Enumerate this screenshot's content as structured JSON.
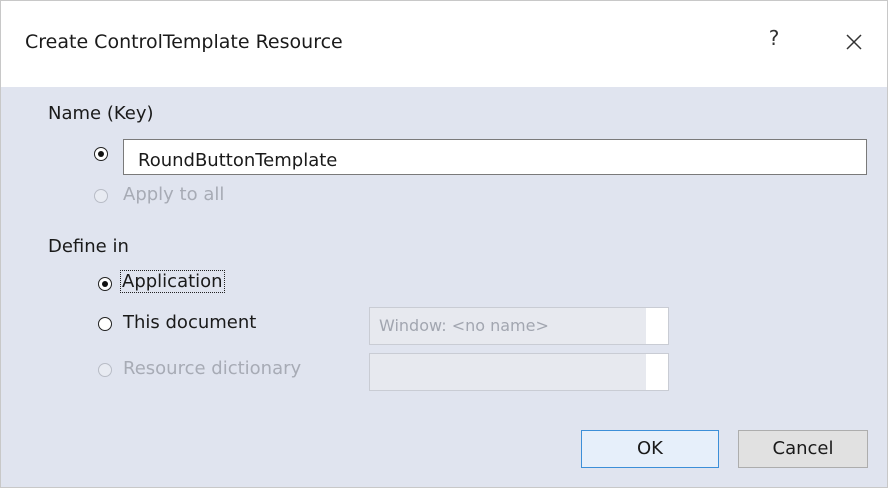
{
  "window": {
    "title": "Create ControlTemplate Resource",
    "help_label": "?",
    "close_icon": "close-icon"
  },
  "name_section": {
    "label": "Name (Key)",
    "key_option_selected": true,
    "key_value": "RoundButtonTemplate",
    "apply_to_all_label": "Apply to all",
    "apply_to_all_enabled": false
  },
  "define_section": {
    "label": "Define in",
    "application_label": "Application",
    "application_selected": true,
    "this_document_label": "This document",
    "this_document_combo_value": "Window: <no name>",
    "resource_dictionary_label": "Resource dictionary",
    "resource_dictionary_enabled": false,
    "resource_dictionary_combo_value": ""
  },
  "buttons": {
    "ok_label": "OK",
    "cancel_label": "Cancel"
  },
  "colors": {
    "dialog_background": "#e0e4ef",
    "default_button_border": "#3c8fd8",
    "disabled_text": "#a7abb5"
  }
}
